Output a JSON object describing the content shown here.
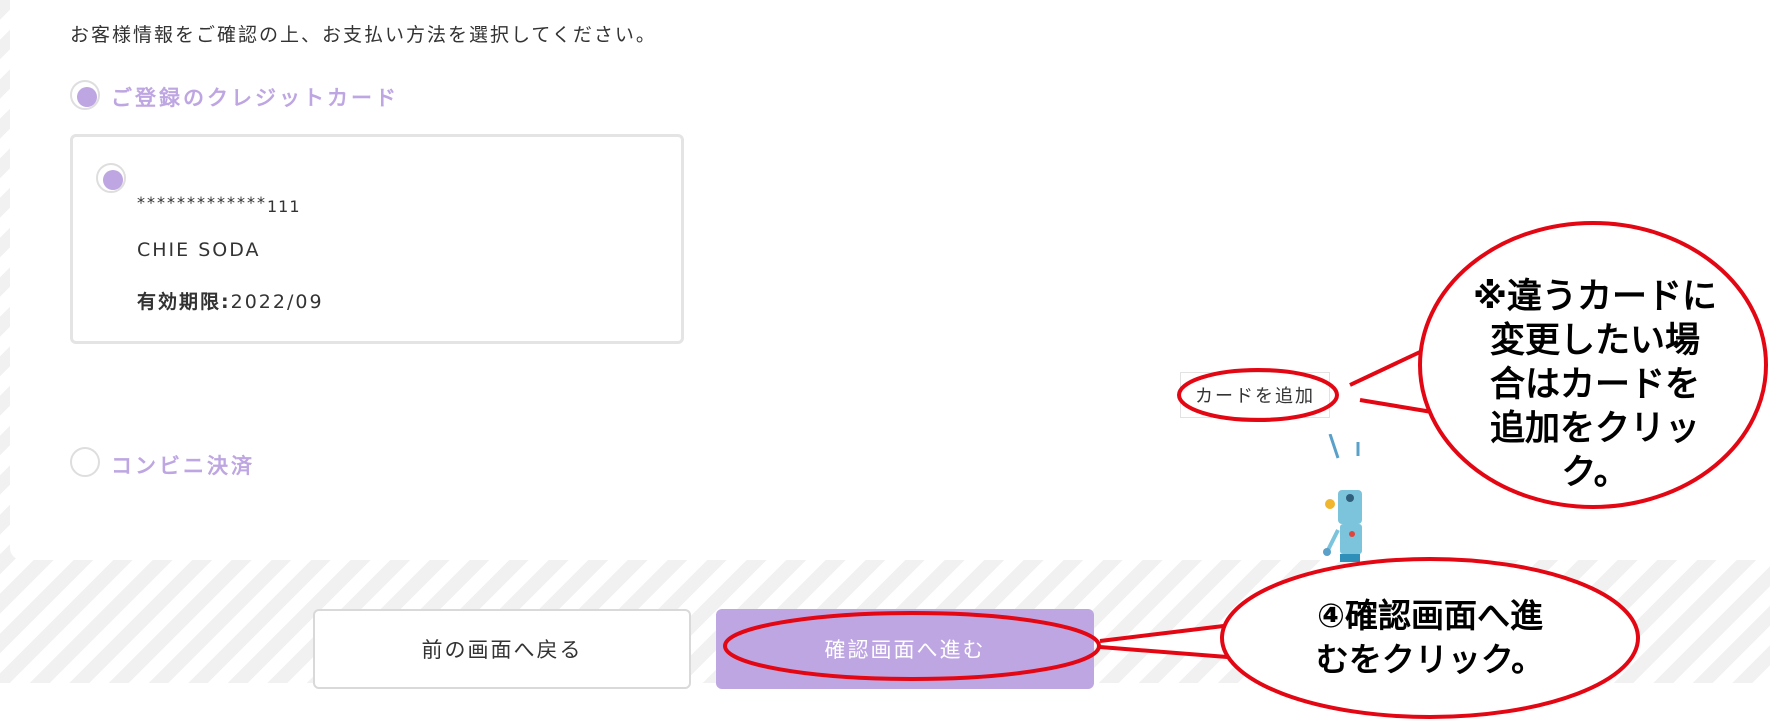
{
  "instruction": "お客様情報をご確認の上、お支払い方法を選択してください。",
  "payment_options": {
    "registered_card": {
      "label": "ご登録のクレジットカード",
      "selected": true,
      "card": {
        "number_mask": "*************",
        "number_last": "111",
        "holder": "CHIE SODA",
        "expiry_label": "有効期限:",
        "expiry_value": "2022/09",
        "selected": true
      }
    },
    "convenience_store": {
      "label": "コンビニ決済",
      "selected": false
    }
  },
  "add_card_button": "カードを追加",
  "buttons": {
    "back": "前の画面へ戻る",
    "next": "確認画面へ進む"
  },
  "callouts": {
    "add_card": [
      "※違うカードに",
      "変更したい場",
      "合はカードを",
      "追加をクリック。"
    ],
    "next": [
      "④確認画面へ進",
      "むをクリック。"
    ]
  },
  "colors": {
    "accent": "#bea6e2",
    "annotation": "#e30613"
  }
}
